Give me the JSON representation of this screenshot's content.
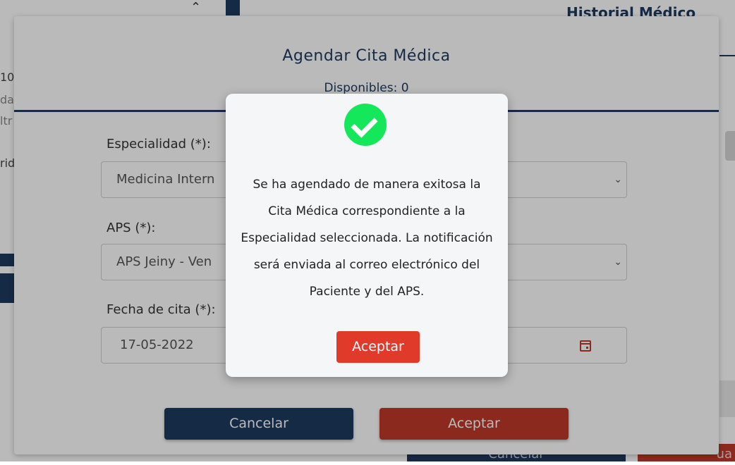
{
  "background": {
    "history_title": "Historial Médico",
    "left_snippets": [
      "10.",
      "da",
      "ltr",
      "rid"
    ],
    "bottom_cancel": "Cancelar",
    "bottom_save": "ua"
  },
  "modal": {
    "title": "Agendar Cita Médica",
    "available": "Disponibles: 0",
    "specialty_label": "Especialidad (*):",
    "specialty_value": "Medicina Intern",
    "aps_label": "APS (*):",
    "aps_value": "APS Jeiny - Ven",
    "date_label": "Fecha de cita (*):",
    "date_value": "17-05-2022",
    "cancel_button": "Cancelar",
    "accept_button": "Aceptar"
  },
  "dialog": {
    "icon": "check-circle-icon",
    "message": "Se ha agendado de manera exitosa la Cita Médica correspondiente a la Especialidad seleccionada. La notificación será enviada al correo electrónico del Paciente y del APS.",
    "accept_button": "Aceptar"
  },
  "colors": {
    "navy": "#1e3a5f",
    "red": "#c0392b",
    "success": "#14e85a"
  }
}
